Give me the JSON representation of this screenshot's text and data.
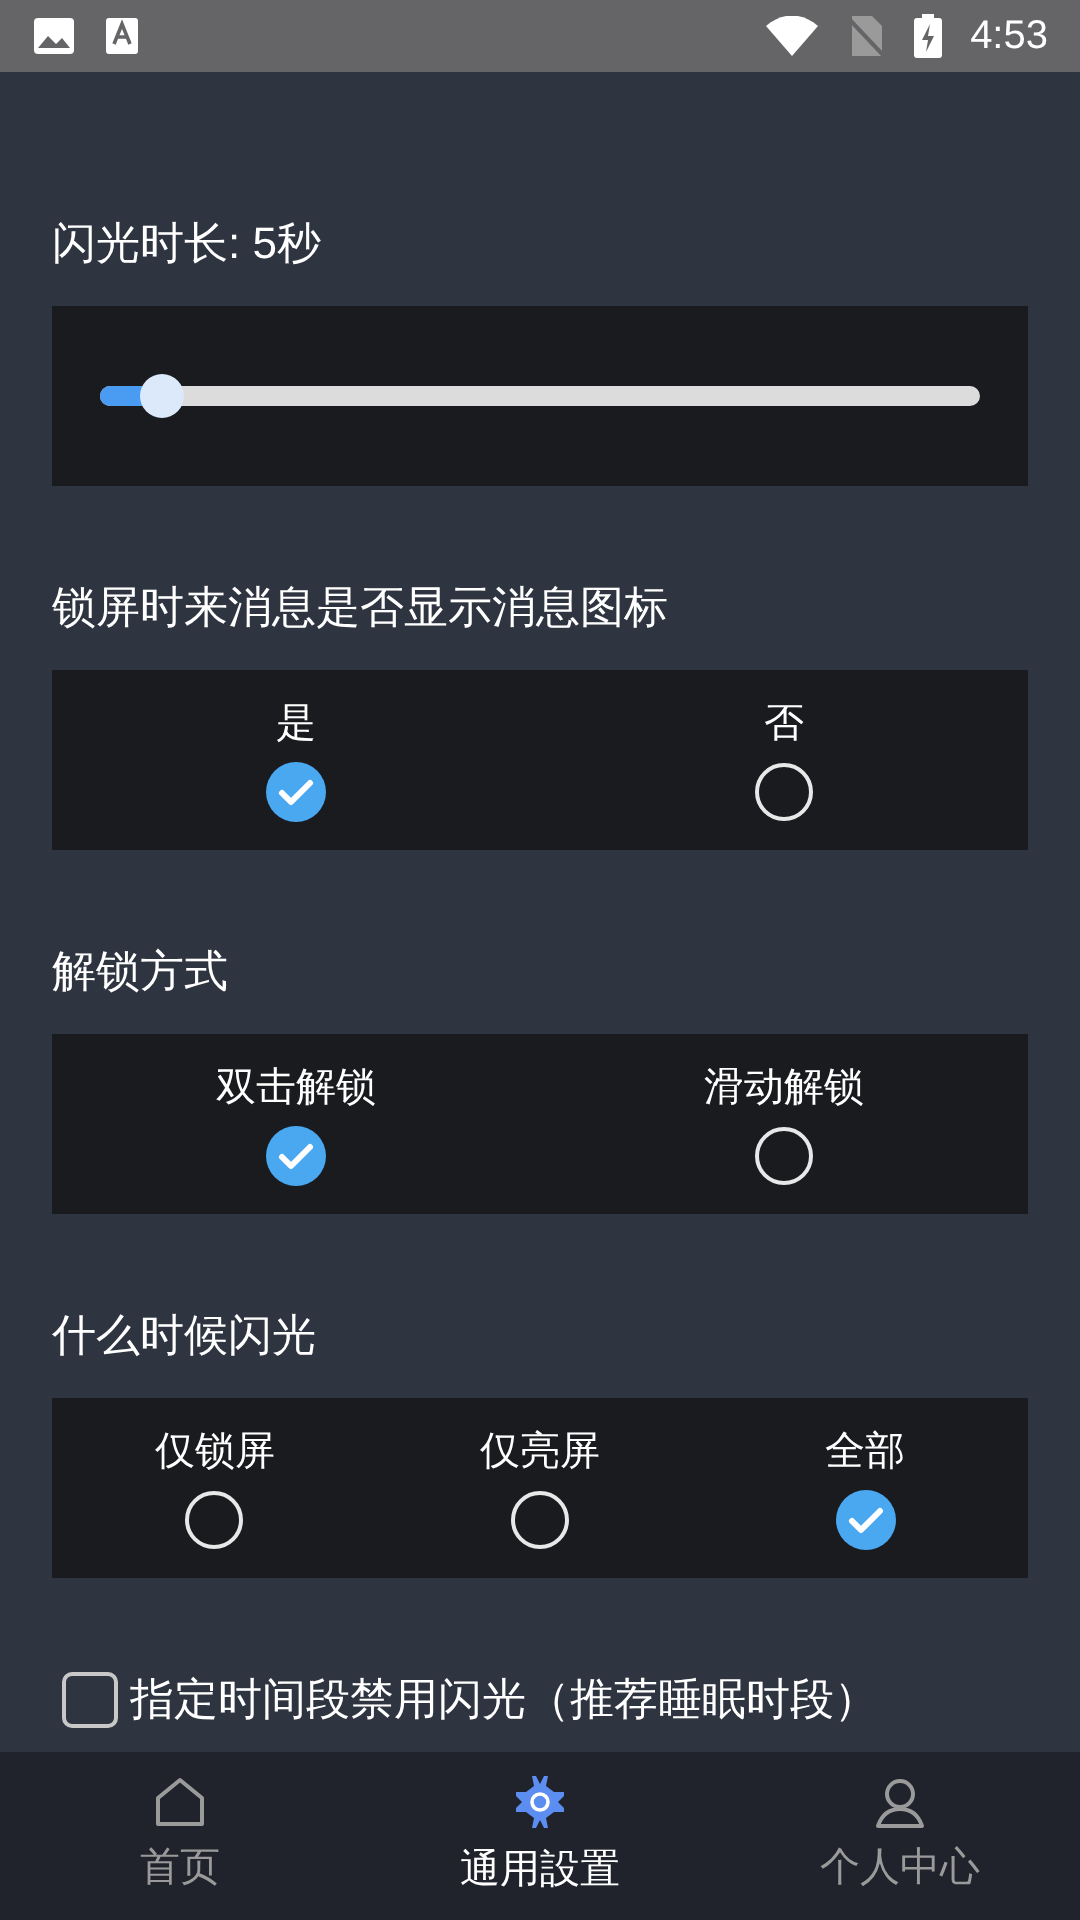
{
  "status_bar": {
    "time": "4:53"
  },
  "duration": {
    "title": "闪光时长: 5秒",
    "level": 0.07
  },
  "groups": [
    {
      "title": "锁屏时来消息是否显示消息图标",
      "options": [
        {
          "label": "是",
          "selected": true
        },
        {
          "label": "否",
          "selected": false
        }
      ]
    },
    {
      "title": "解锁方式",
      "options": [
        {
          "label": "双击解锁",
          "selected": true
        },
        {
          "label": "滑动解锁",
          "selected": false
        }
      ]
    },
    {
      "title": "什么时候闪光",
      "options": [
        {
          "label": "仅锁屏",
          "selected": false
        },
        {
          "label": "仅亮屏",
          "selected": false
        },
        {
          "label": "全部",
          "selected": true
        }
      ]
    }
  ],
  "schedule": {
    "label": "指定时间段禁用闪光（推荐睡眠时段）",
    "checked": false
  },
  "nav": [
    {
      "kind": "home",
      "label": "首页",
      "selected": false
    },
    {
      "kind": "settings",
      "label": "通用設置",
      "selected": true
    },
    {
      "kind": "user",
      "label": "个人中心",
      "selected": false
    }
  ]
}
